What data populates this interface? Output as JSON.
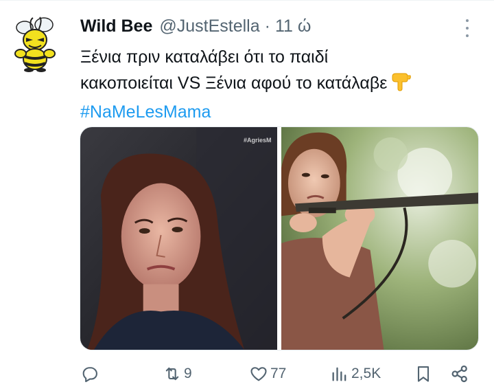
{
  "tweet": {
    "display_name": "Wild Bee",
    "handle": "@JustEstella",
    "separator": "·",
    "time": "11 ώ",
    "text_line1": "Ξένια πριν καταλάβει ότι το παιδί",
    "text_line2": "κακοποιείται VS Ξένια αφού το κατάλαβε",
    "emoji": "👇",
    "hashtag": "#NaMeLesMama",
    "media_watermark": "#AgriesM"
  },
  "actions": {
    "reply_icon": "reply-icon",
    "retweet_icon": "retweet-icon",
    "retweet_count": "9",
    "like_icon": "heart-icon",
    "like_count": "77",
    "views_icon": "views-icon",
    "views_count": "2,5K",
    "bookmark_icon": "bookmark-icon",
    "share_icon": "share-icon"
  },
  "colors": {
    "text": "#0f1419",
    "muted": "#536471",
    "link": "#1d9bf0",
    "avatar_yellow": "#f2e11f"
  }
}
